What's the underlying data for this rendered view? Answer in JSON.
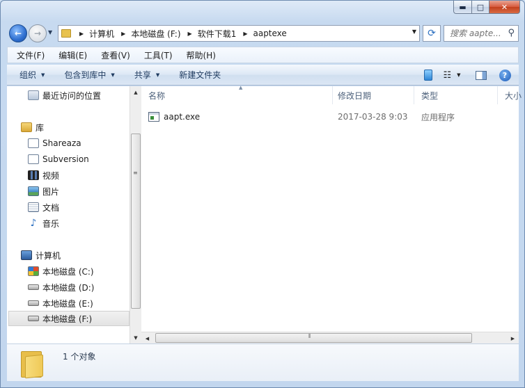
{
  "window": {
    "minimize_glyph": "▬",
    "maximize_glyph": "□",
    "close_glyph": "✕"
  },
  "navigation": {
    "back_glyph": "←",
    "forward_glyph": "→",
    "history_glyph": "▼"
  },
  "address_bar": {
    "breadcrumbs": [
      "计算机",
      "本地磁盘 (F:)",
      "软件下载1",
      "aaptexe"
    ],
    "dropdown_glyph": "▼",
    "refresh_glyph": "⟳"
  },
  "search": {
    "placeholder": "搜索 aapte...",
    "icon": "magnifier-icon",
    "glyph": "⚲"
  },
  "menubar": {
    "items": [
      "文件(F)",
      "编辑(E)",
      "查看(V)",
      "工具(T)",
      "帮助(H)"
    ]
  },
  "commandbar": {
    "items": [
      {
        "label": "组织",
        "has_dropdown": true
      },
      {
        "label": "包含到库中",
        "has_dropdown": true
      },
      {
        "label": "共享",
        "has_dropdown": true
      },
      {
        "label": "新建文件夹",
        "has_dropdown": false
      }
    ],
    "dropdown_glyph": "▼",
    "views_glyph": "☷",
    "help_glyph": "?"
  },
  "sidebar": {
    "favorites": [
      {
        "label": "最近访问的位置",
        "icon": "recent-places-icon"
      }
    ],
    "libraries_header": {
      "label": "库",
      "icon": "libraries-icon"
    },
    "libraries": [
      {
        "label": "Shareaza",
        "icon": "document-library-icon"
      },
      {
        "label": "Subversion",
        "icon": "document-library-icon"
      },
      {
        "label": "视频",
        "icon": "video-icon"
      },
      {
        "label": "图片",
        "icon": "pictures-icon"
      },
      {
        "label": "文档",
        "icon": "documents-icon"
      },
      {
        "label": "音乐",
        "icon": "music-icon"
      }
    ],
    "computer_header": {
      "label": "计算机",
      "icon": "computer-icon"
    },
    "drives": [
      {
        "label": "本地磁盘 (C:)",
        "icon": "system-drive-icon"
      },
      {
        "label": "本地磁盘 (D:)",
        "icon": "drive-icon"
      },
      {
        "label": "本地磁盘 (E:)",
        "icon": "drive-icon"
      },
      {
        "label": "本地磁盘 (F:)",
        "icon": "drive-icon",
        "selected": true
      }
    ],
    "scroll_up_glyph": "▲",
    "scroll_down_glyph": "▼",
    "grip_glyph": "≡"
  },
  "file_list": {
    "sort_glyph": "▲",
    "columns": [
      "名称",
      "修改日期",
      "类型",
      "大小"
    ],
    "rows": [
      {
        "name": "aapt.exe",
        "modified": "2017-03-28 9:03",
        "type": "应用程序",
        "icon": "exe-file-icon"
      }
    ],
    "scroll_left_glyph": "◀",
    "scroll_right_glyph": "▶",
    "grip_glyph": "⦀"
  },
  "status_bar": {
    "count_text": "1 个对象",
    "icon": "folder-icon"
  }
}
